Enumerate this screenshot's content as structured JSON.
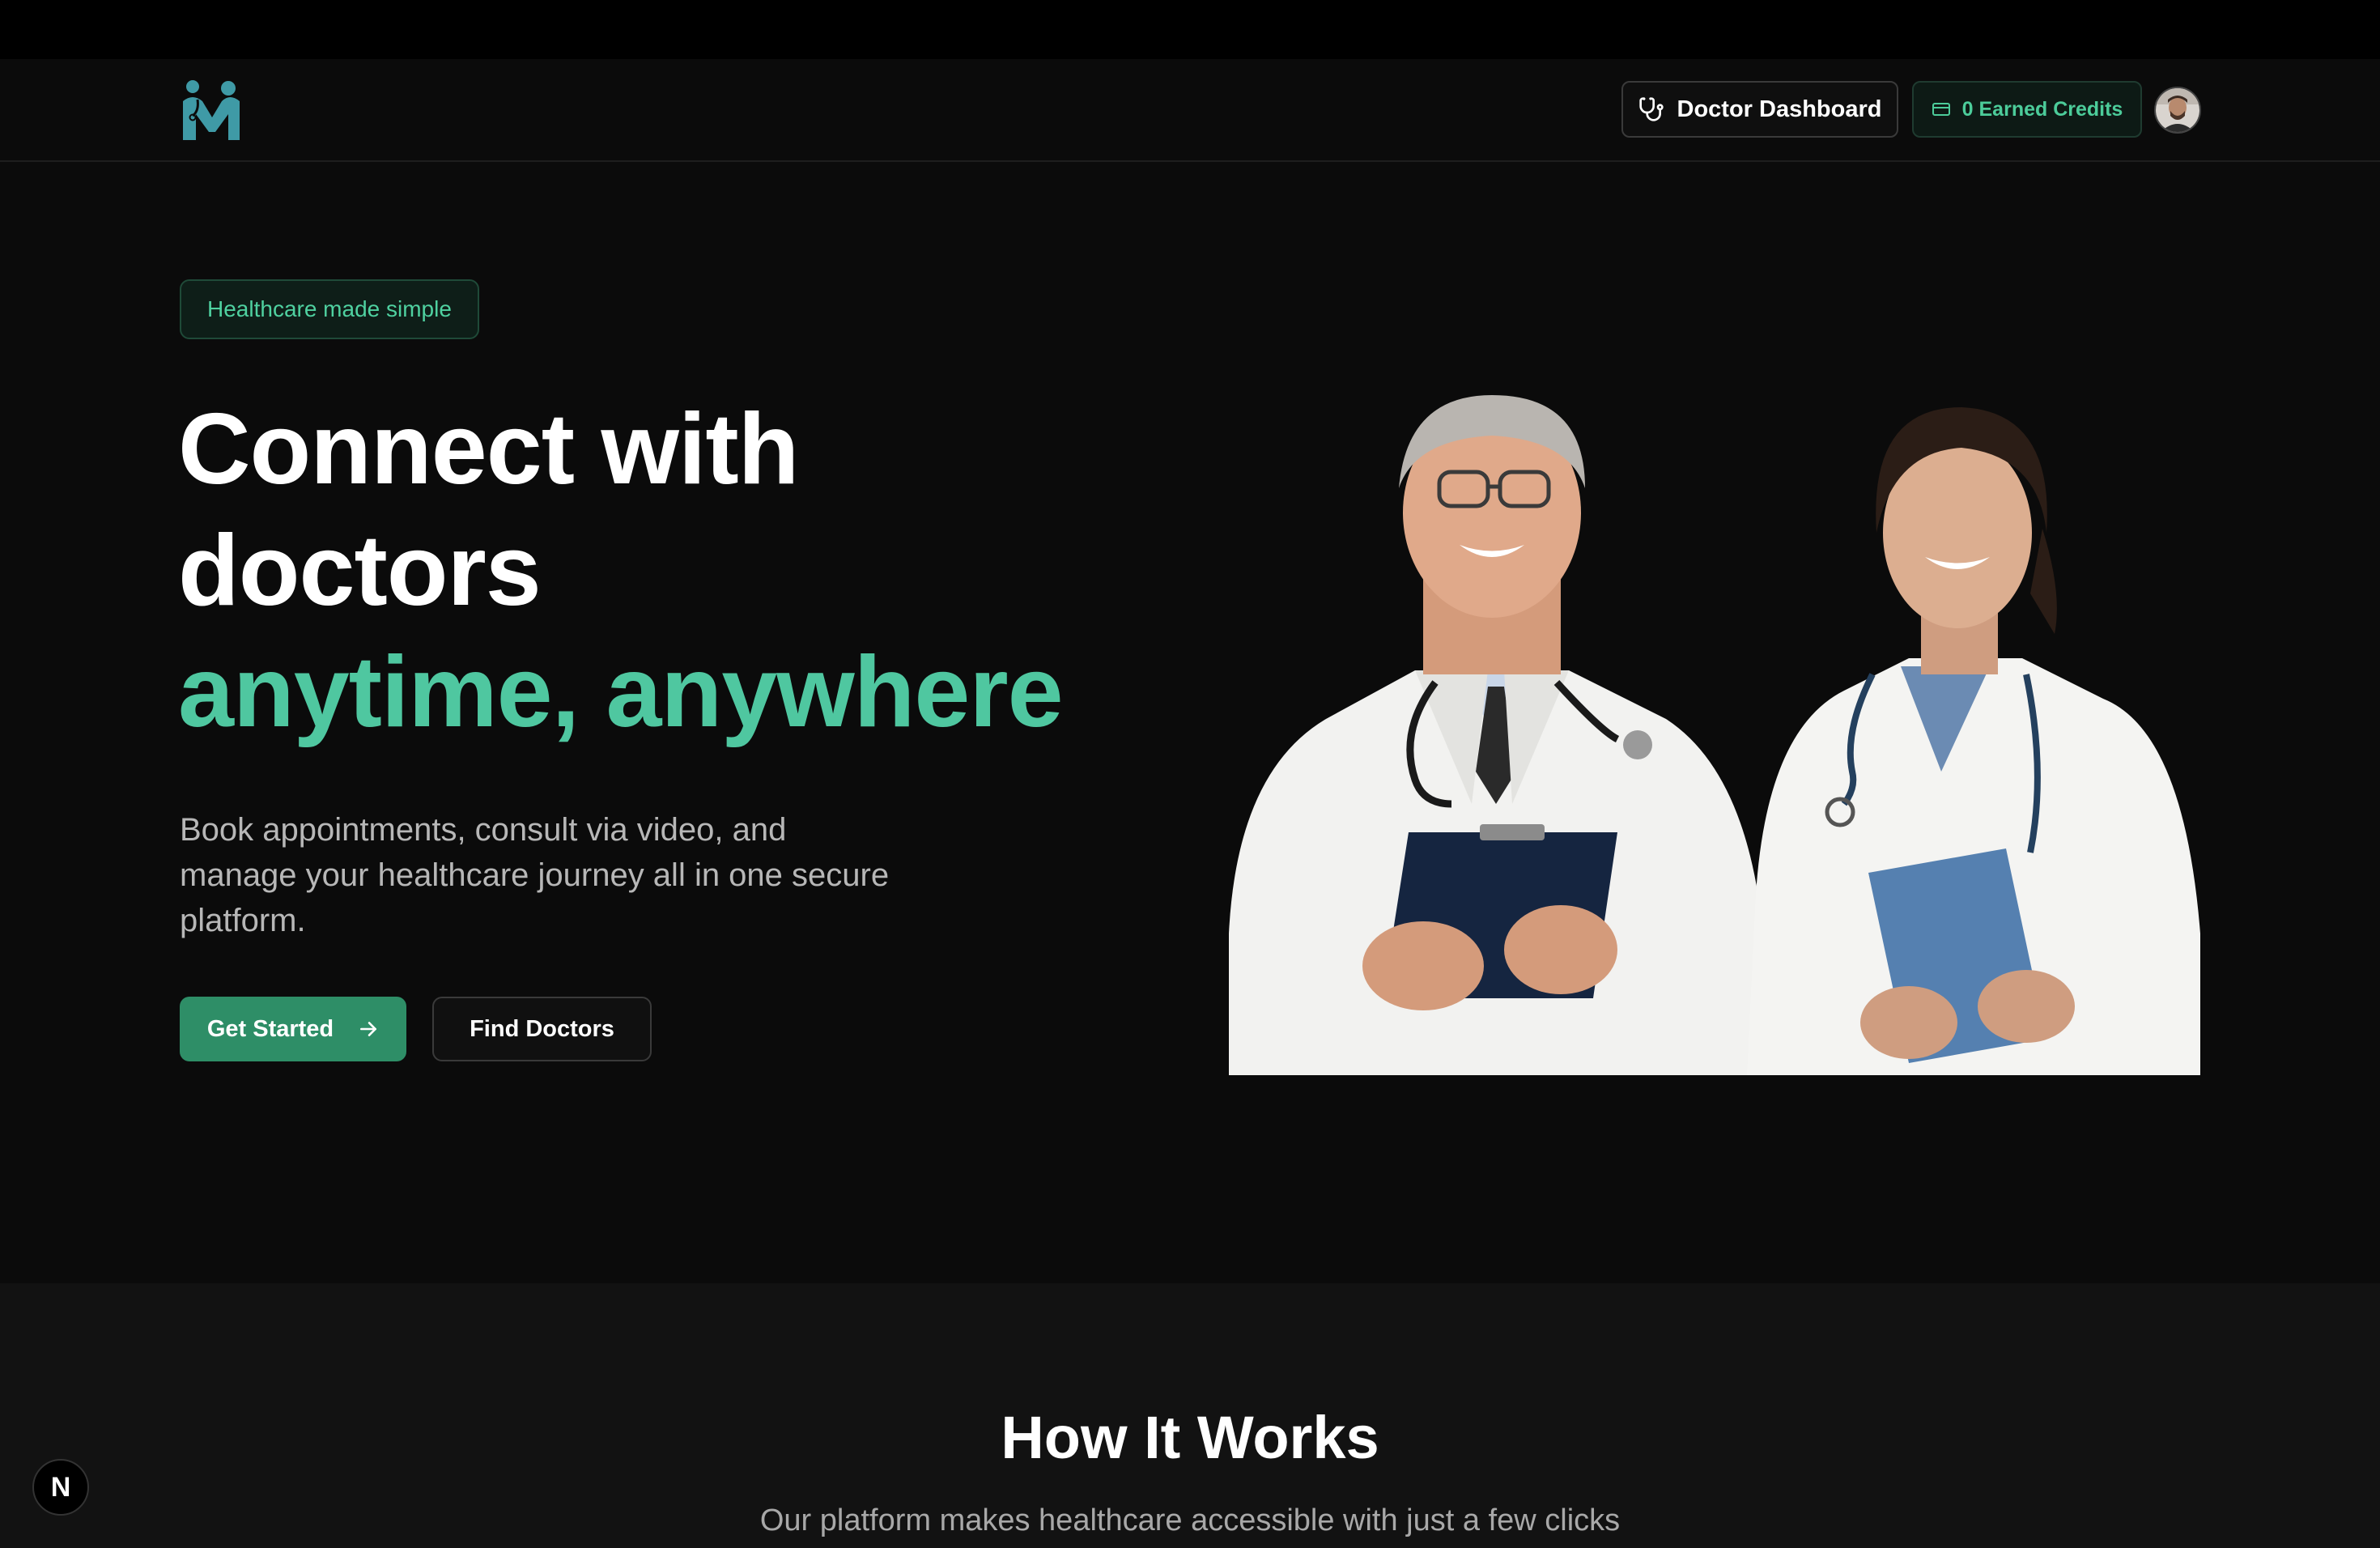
{
  "navbar": {
    "logo_icon": "medical-m-logo",
    "dashboard_label": "Doctor Dashboard",
    "dashboard_icon": "stethoscope-icon",
    "credits_label": "0 Earned Credits",
    "credits_icon": "credit-card-icon",
    "avatar_icon": "user-avatar"
  },
  "hero": {
    "badge": "Healthcare made simple",
    "headline_line1": "Connect with",
    "headline_line2": "doctors",
    "headline_accent": "anytime, anywhere",
    "description": "Book appointments, consult via video, and manage your healthcare journey all in one secure platform.",
    "get_started_label": "Get Started",
    "get_started_icon": "arrow-right-icon",
    "find_doctors_label": "Find Doctors"
  },
  "how_it_works": {
    "title": "How It Works",
    "subtitle": "Our platform makes healthcare accessible with just a few clicks"
  },
  "dev_badge": {
    "label": "N"
  },
  "colors": {
    "accent": "#4fc7a0",
    "primary_button": "#2e8e67",
    "background": "#0b0b0b"
  }
}
